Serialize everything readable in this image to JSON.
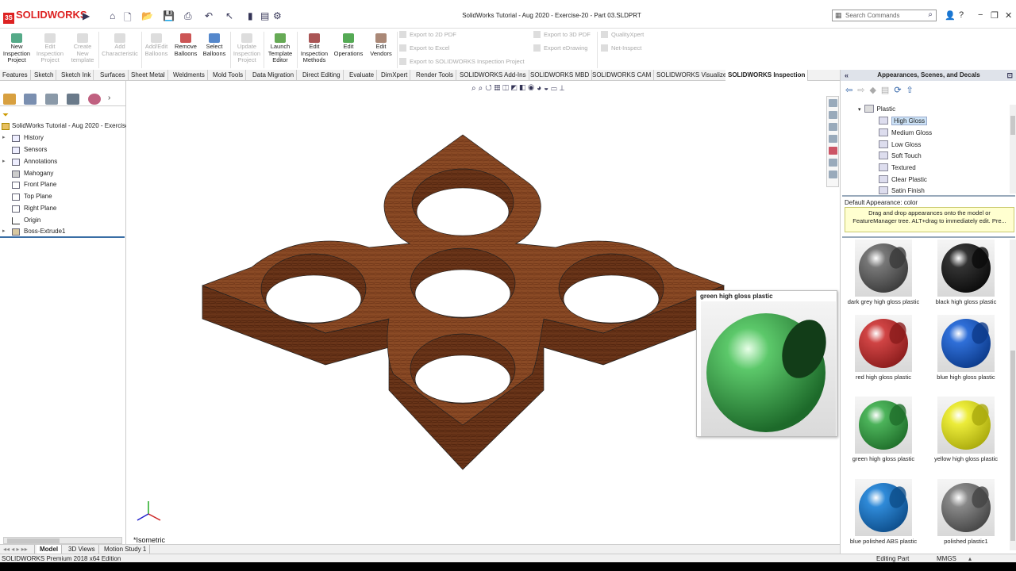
{
  "app": {
    "brand": "SOLIDWORKS",
    "doc_title": "SolidWorks Tutorial - Aug 2020 - Exercise-20 - Part 03.SLDPRT",
    "search_placeholder": "Search Commands"
  },
  "ribbon": {
    "buttons": [
      {
        "label": "New\nInspection\nProject",
        "enabled": true
      },
      {
        "label": "Edit\nInspection\nProject",
        "enabled": false
      },
      {
        "label": "Create\nNew\ntemplate",
        "enabled": false
      },
      {
        "label": "Add\nCharacteristic",
        "enabled": false
      },
      {
        "label": "Add/Edit\nBalloons",
        "enabled": false
      },
      {
        "label": "Remove\nBalloons",
        "enabled": true
      },
      {
        "label": "Select\nBalloons",
        "enabled": true
      },
      {
        "label": "Update\nInspection\nProject",
        "enabled": false
      },
      {
        "label": "Launch\nTemplate\nEditor",
        "enabled": true
      },
      {
        "label": "Edit\nInspection\nMethods",
        "enabled": true
      },
      {
        "label": "Edit\nOperations",
        "enabled": true
      },
      {
        "label": "Edit\nVendors",
        "enabled": true
      }
    ],
    "exports": [
      "Export to 2D PDF",
      "Export to Excel",
      "Export to SOLIDWORKS Inspection Project",
      "Export to 3D PDF",
      "Export eDrawing",
      "QualityXpert",
      "Net-Inspect"
    ]
  },
  "tabs": [
    "Features",
    "Sketch",
    "Sketch Ink",
    "Surfaces",
    "Sheet Metal",
    "Weldments",
    "Mold Tools",
    "Data Migration",
    "Direct Editing",
    "Evaluate",
    "DimXpert",
    "Render Tools",
    "SOLIDWORKS Add-Ins",
    "SOLIDWORKS MBD",
    "SOLIDWORKS CAM",
    "SOLIDWORKS Visualize",
    "SOLIDWORKS Inspection"
  ],
  "active_tab": "SOLIDWORKS Inspection",
  "tree": {
    "root": "SolidWorks Tutorial - Aug 2020 - Exercise",
    "items": [
      {
        "label": "History",
        "expander": true
      },
      {
        "label": "Sensors",
        "expander": false
      },
      {
        "label": "Annotations",
        "expander": true
      },
      {
        "label": "Mahogany",
        "expander": false
      },
      {
        "label": "Front Plane",
        "expander": false
      },
      {
        "label": "Top Plane",
        "expander": false
      },
      {
        "label": "Right Plane",
        "expander": false
      },
      {
        "label": "Origin",
        "expander": false
      },
      {
        "label": "Boss-Extrude1",
        "expander": true
      }
    ]
  },
  "viewport": {
    "view_name": "*Isometric",
    "material_color": "#8a4a25"
  },
  "tooltip": {
    "title": "green high gloss plastic"
  },
  "panel": {
    "title": "Appearances, Scenes, and Decals",
    "folder": "Plastic",
    "subfolders": [
      "High Gloss",
      "Medium Gloss",
      "Low Gloss",
      "Soft Touch",
      "Textured",
      "Clear Plastic",
      "Satin Finish"
    ],
    "selected_subfolder": "High Gloss",
    "default_appearance": "Default Appearance: color",
    "hint": "Drag and drop appearances onto the model or FeatureManager tree.  ALT+drag to immediately edit.  Pre...",
    "swatches": [
      {
        "label": "dark grey high gloss plastic",
        "color": "#777777",
        "dark": "#3a3a3a"
      },
      {
        "label": "black high gloss plastic",
        "color": "#333333",
        "dark": "#0a0a0a"
      },
      {
        "label": "red high gloss plastic",
        "color": "#d04444",
        "dark": "#8a1c1c"
      },
      {
        "label": "blue high gloss plastic",
        "color": "#2f6fd8",
        "dark": "#0c3a8a"
      },
      {
        "label": "green high gloss plastic",
        "color": "#4cb35a",
        "dark": "#1f6e2a"
      },
      {
        "label": "yellow high gloss plastic",
        "color": "#ecec3a",
        "dark": "#a9a90c"
      },
      {
        "label": "blue polished ABS plastic",
        "color": "#2f8ad8",
        "dark": "#0d4d8a"
      },
      {
        "label": "polished plastic1",
        "color": "#888888",
        "dark": "#444444"
      }
    ]
  },
  "bottom_tabs": [
    "Model",
    "3D Views",
    "Motion Study 1"
  ],
  "active_bottom_tab": "Model",
  "status": {
    "edition": "SOLIDWORKS Premium 2018 x64 Edition",
    "mode": "Editing Part",
    "units": "MMGS"
  }
}
